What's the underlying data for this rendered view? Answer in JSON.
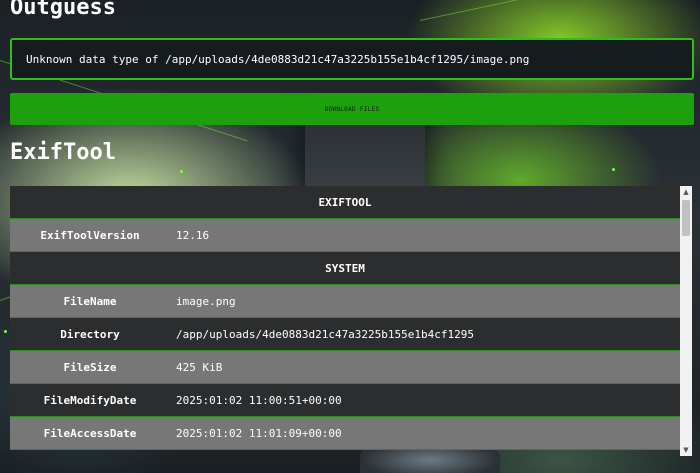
{
  "outguess": {
    "title": "Outguess",
    "message": "Unknown data type of /app/uploads/4de0883d21c47a3225b155e1b4cf1295/image.png",
    "download_label": "DOWNLOAD FILES"
  },
  "exiftool": {
    "title": "ExifTool",
    "sections": {
      "exiftool": "EXIFTOOL",
      "system": "SYSTEM"
    },
    "rows": {
      "exiftool_version": {
        "key": "ExifToolVersion",
        "value": "12.16"
      },
      "file_name": {
        "key": "FileName",
        "value": "image.png"
      },
      "directory": {
        "key": "Directory",
        "value": "/app/uploads/4de0883d21c47a3225b155e1b4cf1295"
      },
      "file_size": {
        "key": "FileSize",
        "value": "425 KiB"
      },
      "file_modify_date": {
        "key": "FileModifyDate",
        "value": "2025:01:02 11:00:51+00:00"
      },
      "file_access_date": {
        "key": "FileAccessDate",
        "value": "2025:01:02 11:01:09+00:00"
      }
    }
  },
  "icons": {
    "scroll_up": "scroll-up-arrow-icon",
    "scroll_down": "scroll-down-arrow-icon"
  },
  "colors": {
    "accent_green": "#2fbd1a",
    "button_green": "#1ca00e",
    "row_dark": "#2b2d2f",
    "row_grey": "#777777"
  }
}
